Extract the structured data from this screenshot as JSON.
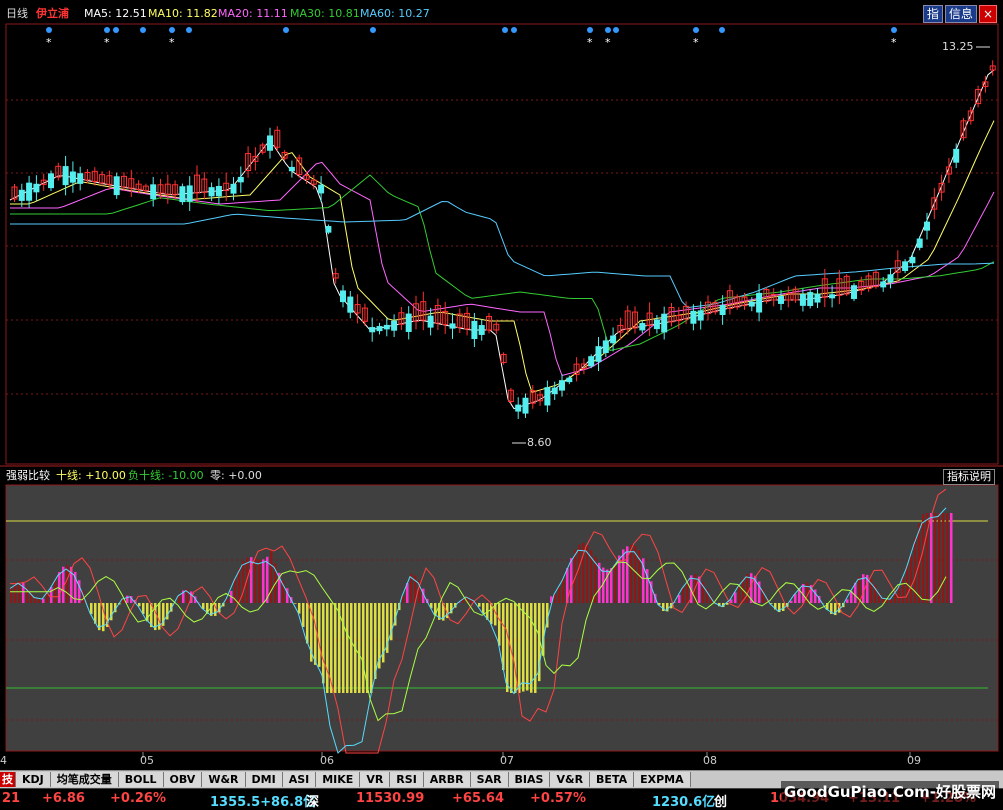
{
  "header": {
    "period": "日线",
    "stock_name": "伊立浦",
    "ma5": "MA5: 12.51",
    "ma10": "MA10: 11.82",
    "ma20": "MA20: 11.11",
    "ma30": "MA30: 10.81",
    "ma60": "MA60: 10.27",
    "colors": {
      "ma5": "#ffffff",
      "ma10": "#ffff66",
      "ma20": "#ff66ff",
      "ma30": "#33cc33",
      "ma60": "#55ccff"
    }
  },
  "toolbar": {
    "zhi_label": "指",
    "info_label": "信息",
    "close_label": "×"
  },
  "price_panel": {
    "high_label": "13.25",
    "low_label": "8.60",
    "star": "*"
  },
  "indicator": {
    "name": "强弱比较",
    "line_pos": "十线: +10.00",
    "line_neg": "负十线: -10.00",
    "zero": "零: +0.00",
    "legend_label": "指标说明"
  },
  "x_axis": {
    "months": [
      "05",
      "06",
      "07",
      "08",
      "09"
    ],
    "left_edge": "4"
  },
  "tabs": [
    "KDJ",
    "均笔成交量",
    "BOLL",
    "OBV",
    "W&R",
    "DMI",
    "ASI",
    "MIKE",
    "VR",
    "RSI",
    "ARBR",
    "SAR",
    "BIAS",
    "V&R",
    "BETA",
    "EXPMA"
  ],
  "tab_left_marker": "技",
  "status_bar": {
    "v1": "21",
    "v2": "+6.86",
    "v3": "+0.26%",
    "v4": "1355.5+86.8亿",
    "v5": "深",
    "v6": "11530.99",
    "v7": "+65.64",
    "v8": "+0.57%",
    "v9": "1230.6亿",
    "v10": "创",
    "v11": "1034.94",
    "v12": "+13.11",
    "v13": "+1.28%"
  },
  "watermark": "GoodGuPiao.Com-好股票网"
}
